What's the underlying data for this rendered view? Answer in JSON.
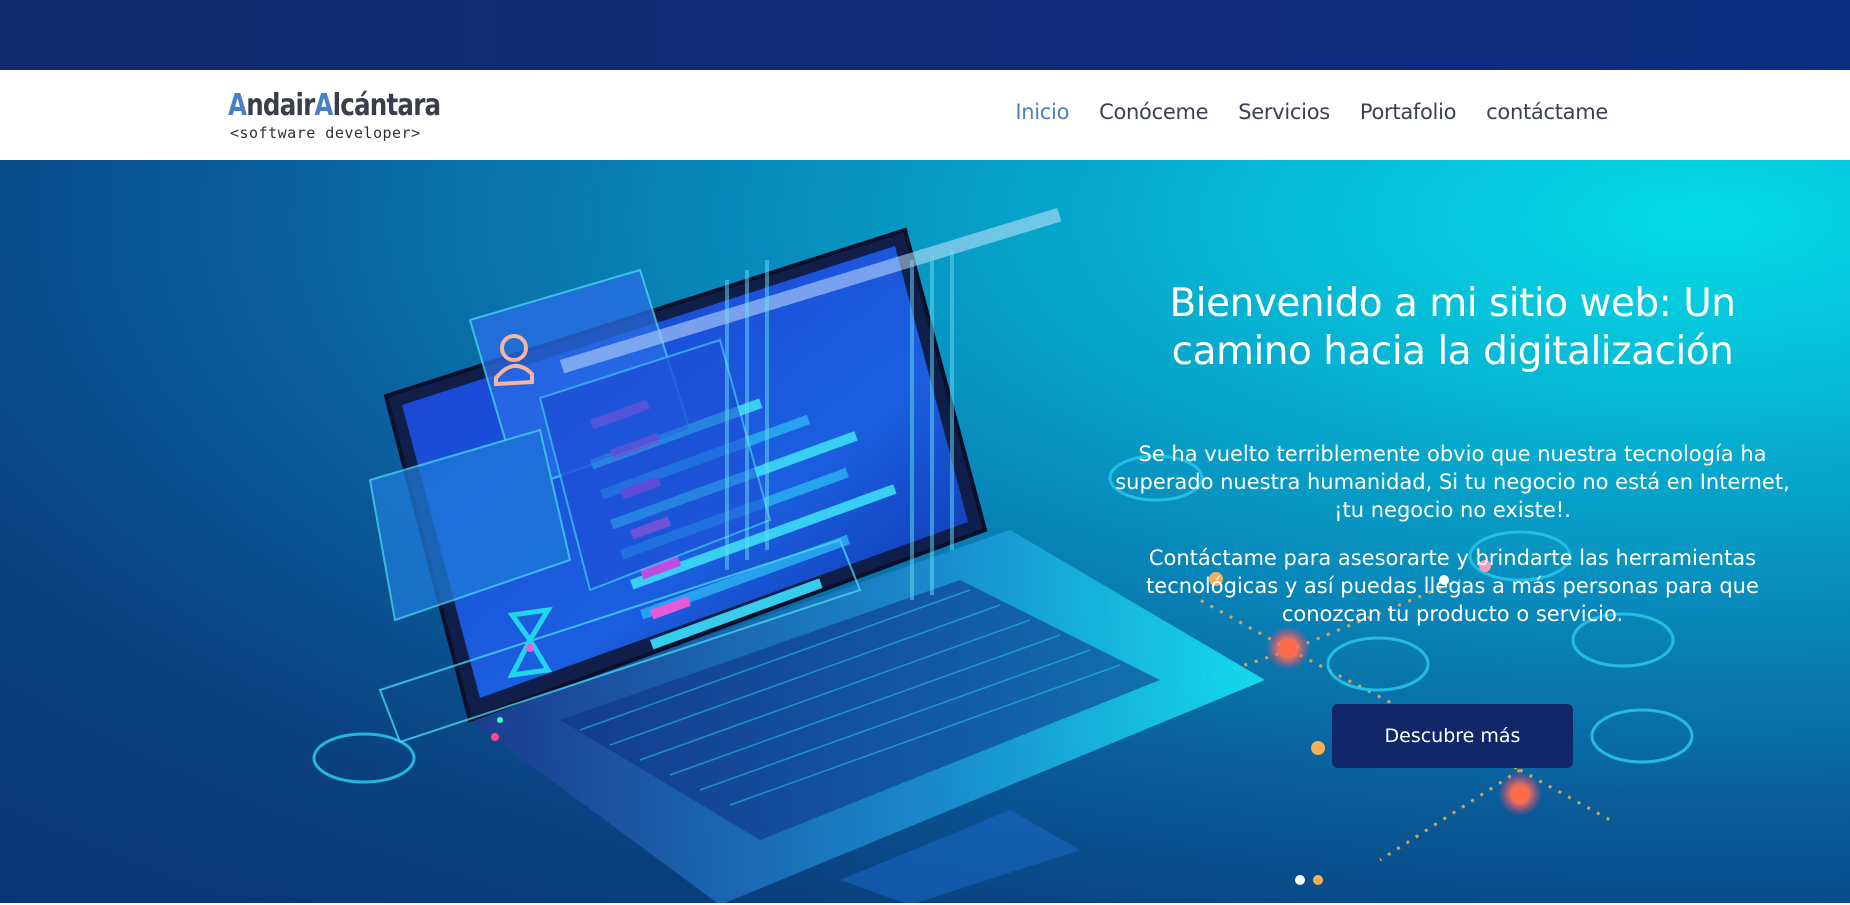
{
  "logo": {
    "first": "A",
    "first_rest": "ndair",
    "second": "A",
    "second_rest": "lcántara",
    "subtitle": "<software developer>"
  },
  "nav": {
    "items": [
      {
        "label": "Inicio",
        "active": true
      },
      {
        "label": "Conóceme",
        "active": false
      },
      {
        "label": "Servicios",
        "active": false
      },
      {
        "label": "Portafolio",
        "active": false
      },
      {
        "label": "contáctame",
        "active": false
      }
    ]
  },
  "hero": {
    "title": "Bienvenido a mi sitio web: Un camino hacia la digitalización",
    "paragraph1": "Se ha vuelto terriblemente obvio que nuestra tecnología ha superado nuestra humanidad, Si tu negocio no está en Internet, ¡tu negocio no existe!.",
    "paragraph2": "Contáctame para asesorarte y brindarte las herramientas tecnológicas y así puedas llegas a más personas para que conozcan tu producto o servicio.",
    "cta_label": "Descubre más"
  },
  "colors": {
    "topbar": "#0f2a78",
    "nav_active": "#4a80c9",
    "nav_text": "#3a4154",
    "cta_bg": "#11276a",
    "hero_accent": "#05dbe6"
  }
}
